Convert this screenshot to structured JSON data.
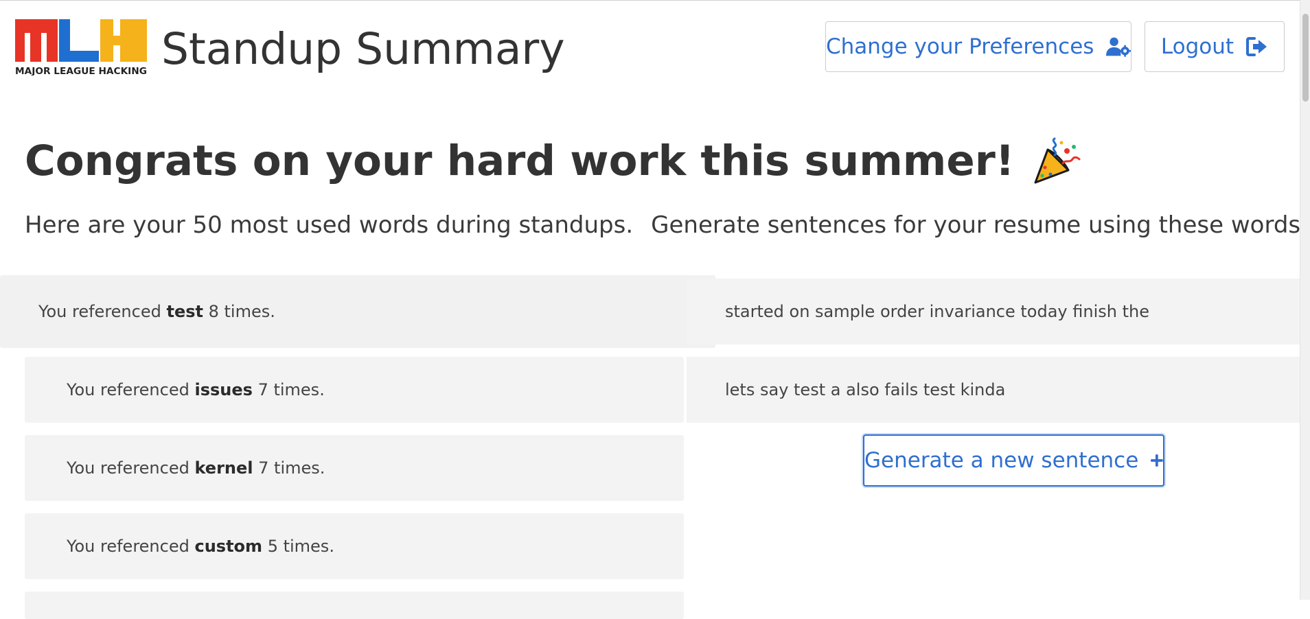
{
  "header": {
    "logo_mark": "MLH",
    "logo_text": "MAJOR LEAGUE HACKING",
    "title": "Standup Summary",
    "prefs_button": "Change your Preferences",
    "prefs_icon": "user-gear-icon",
    "logout_button": "Logout",
    "logout_icon": "sign-out-icon"
  },
  "main": {
    "heading": "Congrats on your hard work this summer!",
    "heading_icon": "party-popper-icon",
    "subheading_words": "Here are your 50 most used words during standups.",
    "subheading_generate": "Generate sentences for your resume using these words."
  },
  "words": [
    {
      "prefix": "You referenced",
      "word": "test",
      "suffix": "8 times."
    },
    {
      "prefix": "You referenced",
      "word": "issues",
      "suffix": "7 times."
    },
    {
      "prefix": "You referenced",
      "word": "kernel",
      "suffix": "7 times."
    },
    {
      "prefix": "You referenced",
      "word": "custom",
      "suffix": "5 times."
    }
  ],
  "sentences": [
    "started on sample order invariance today finish the",
    "lets say test a also fails test kinda"
  ],
  "generate_button": "Generate a new sentence",
  "generate_icon": "plus-icon",
  "colors": {
    "accent": "#2f6fd0",
    "logo_red": "#e73427",
    "logo_blue": "#1f6fd0",
    "logo_yellow": "#f6b21b",
    "card_bg": "#f3f3f3",
    "text": "#333333"
  }
}
